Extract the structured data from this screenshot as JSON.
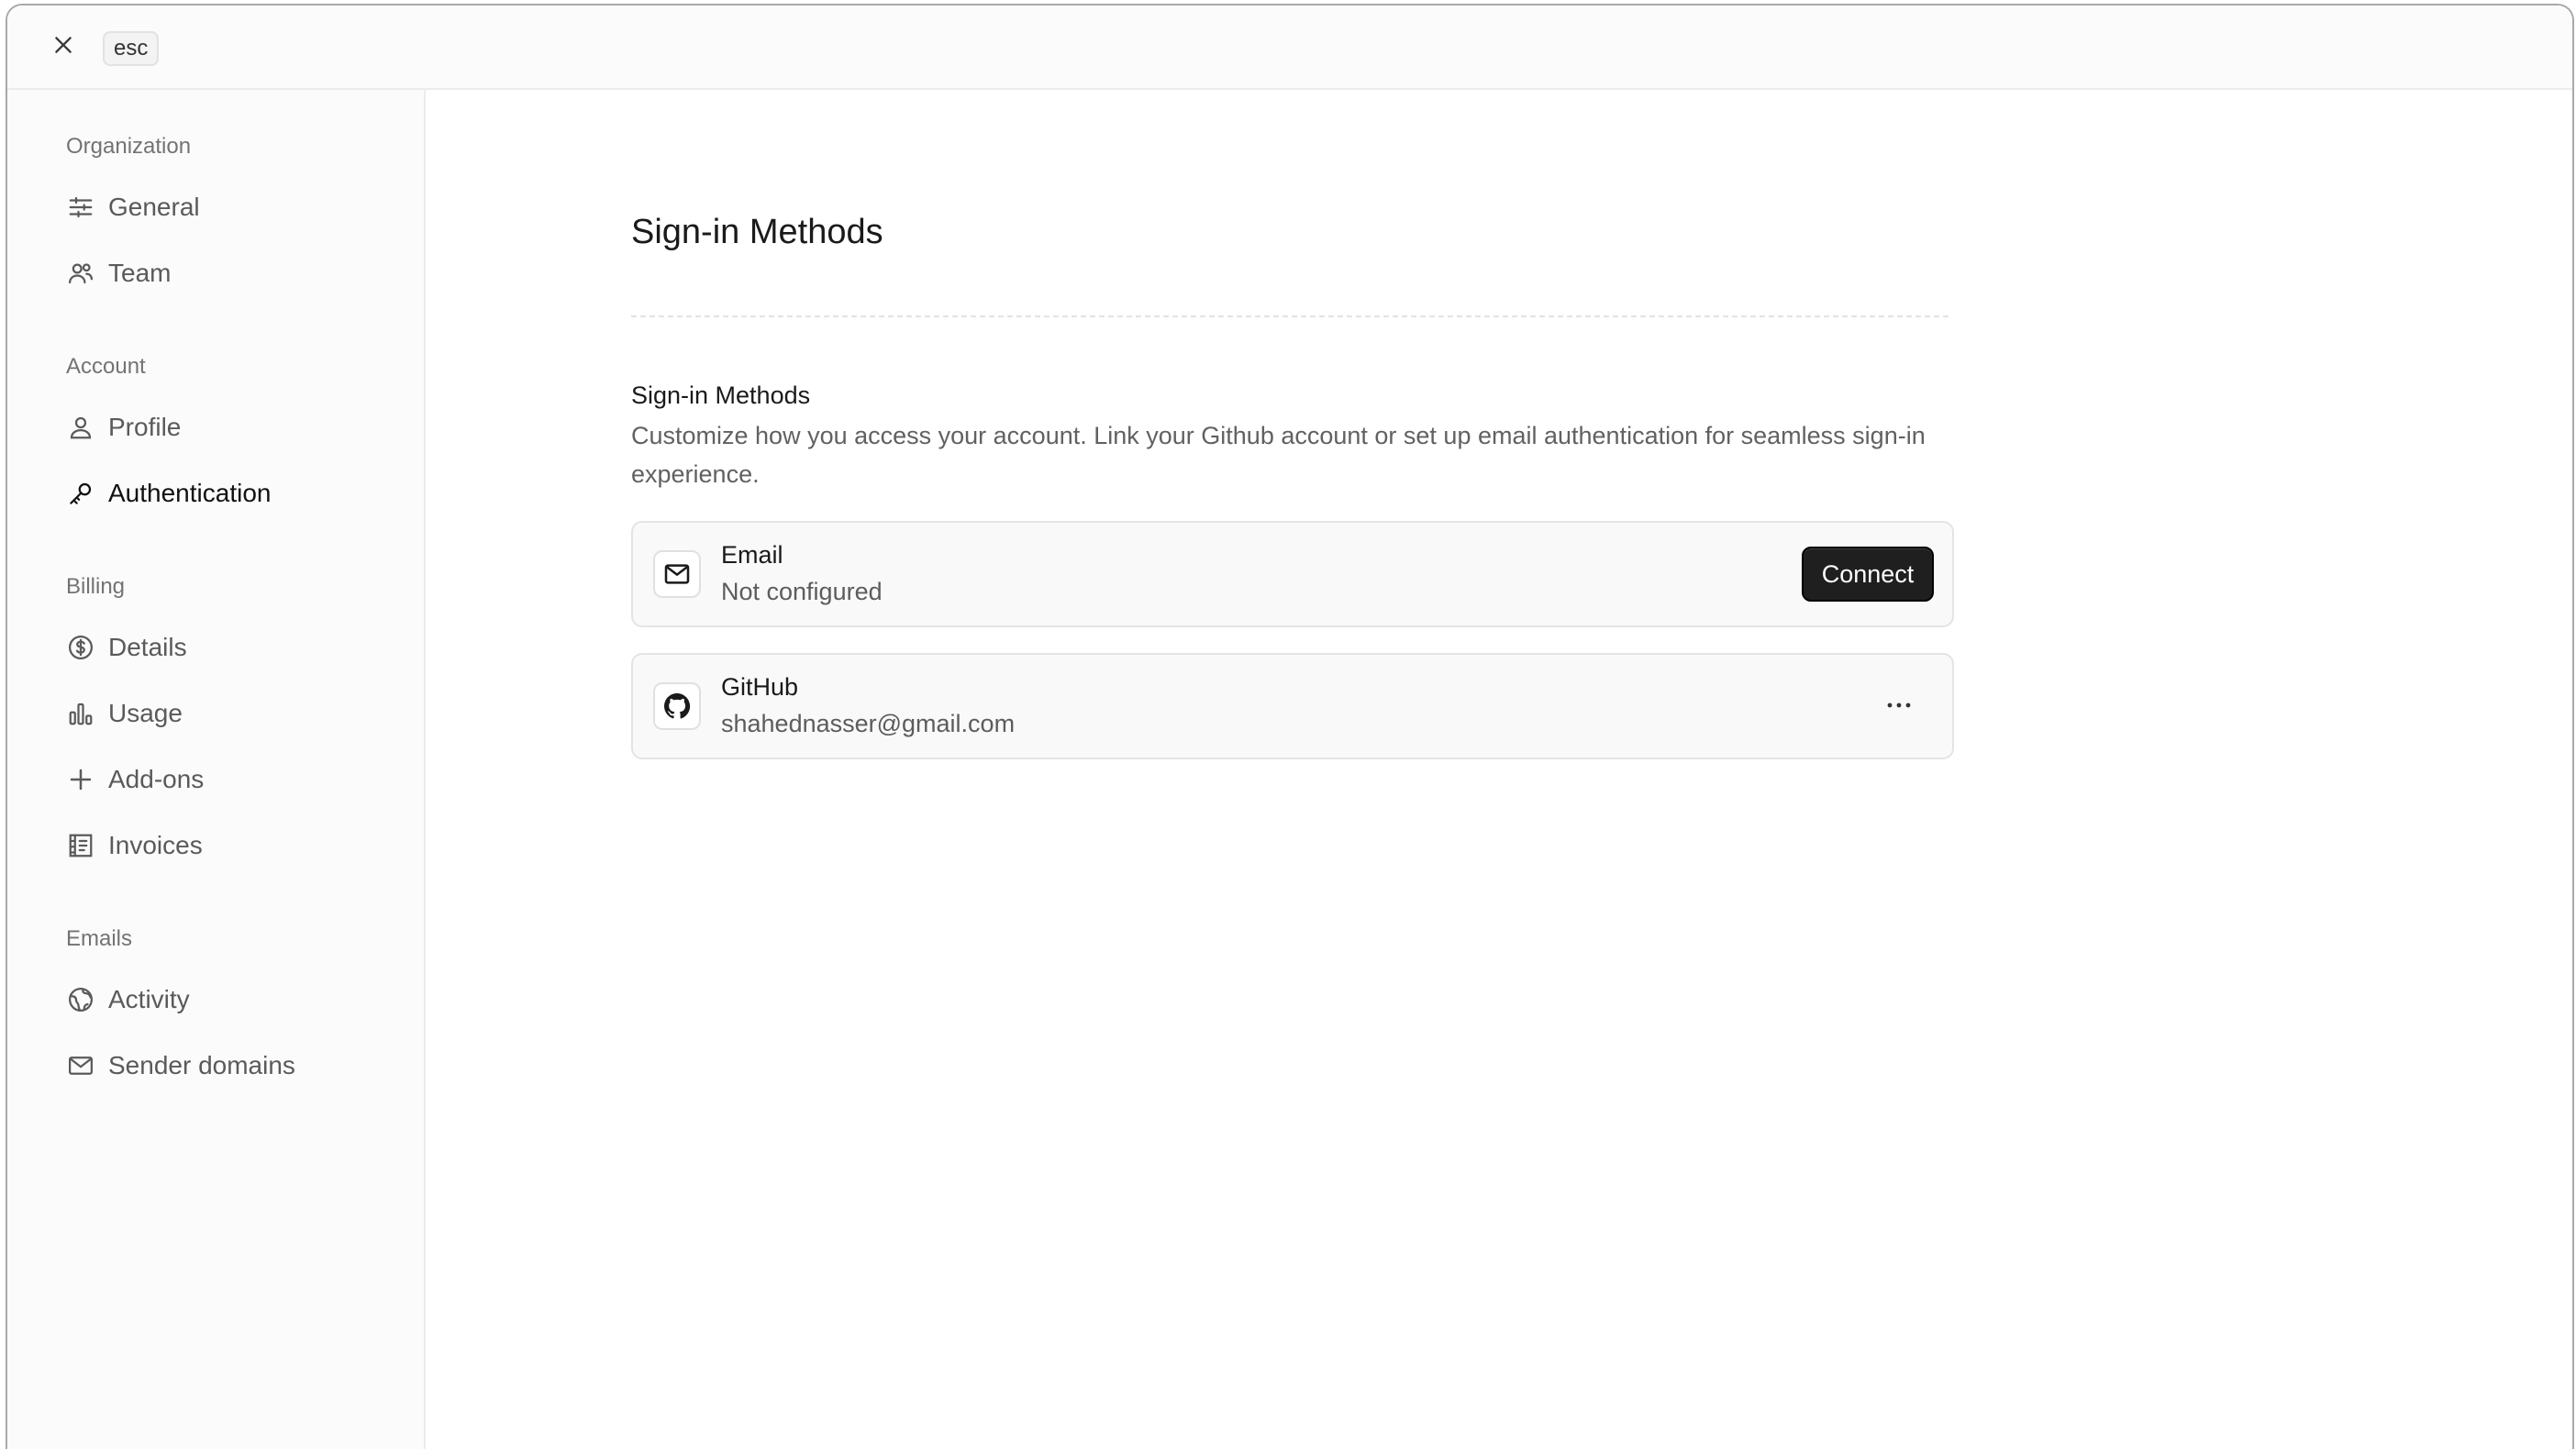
{
  "topbar": {
    "close_icon": "close-icon",
    "esc_label": "esc"
  },
  "sidebar": {
    "groups": [
      {
        "label": "Organization",
        "items": [
          {
            "label": "General",
            "icon": "sliders-icon"
          },
          {
            "label": "Team",
            "icon": "users-icon"
          }
        ]
      },
      {
        "label": "Account",
        "items": [
          {
            "label": "Profile",
            "icon": "user-icon"
          },
          {
            "label": "Authentication",
            "icon": "key-icon",
            "active": true
          }
        ]
      },
      {
        "label": "Billing",
        "items": [
          {
            "label": "Details",
            "icon": "dollar-circle-icon"
          },
          {
            "label": "Usage",
            "icon": "bar-chart-icon"
          },
          {
            "label": "Add-ons",
            "icon": "plus-icon"
          },
          {
            "label": "Invoices",
            "icon": "receipt-icon"
          }
        ]
      },
      {
        "label": "Emails",
        "items": [
          {
            "label": "Activity",
            "icon": "globe-icon"
          },
          {
            "label": "Sender domains",
            "icon": "mail-icon"
          }
        ]
      }
    ]
  },
  "main": {
    "page_title": "Sign-in Methods",
    "section_title": "Sign-in Methods",
    "section_description": "Customize how you access your account. Link your Github account or set up email authentication for seamless sign-in experience.",
    "methods": [
      {
        "name": "Email",
        "status": "Not configured",
        "icon": "mail-icon",
        "action_label": "Connect"
      },
      {
        "name": "GitHub",
        "status": "shahednasser@gmail.com",
        "icon": "github-icon",
        "action_icon": "more-horizontal-icon"
      }
    ]
  },
  "colors": {
    "accent_button": "#1f1f1f",
    "sidebar_bg": "#fbfbfb",
    "border": "#e4e4e4"
  }
}
